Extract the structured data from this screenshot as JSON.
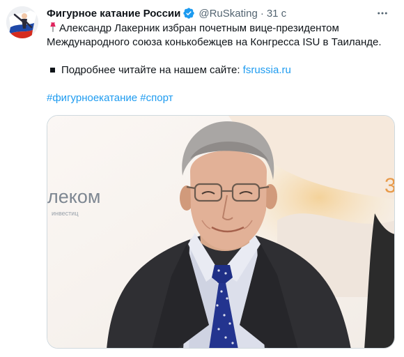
{
  "author": {
    "name": "Фигурное катание России",
    "handle": "@RuSkating",
    "time": "31 с"
  },
  "tweet": {
    "line1": "Александр Лакерник избран почетным вице-президентом",
    "line2": "Международного союза конькобежцев на Конгресса ISU в Таиланде.",
    "read_more": "Подробнее читайте на нашем сайте:",
    "link": "fsrussia.ru",
    "hashtags": "#фигурноекатание #спорт"
  },
  "media": {
    "background_text": "лeком",
    "background_subtext": "инвестиц",
    "number_fragment": "3"
  },
  "icons": {
    "pin": "pushpin-icon",
    "verified": "verified-badge-icon",
    "more": "more-options-icon"
  },
  "colors": {
    "link": "#1d9bf0",
    "secondary_text": "#536471",
    "verified": "#1d9bf0"
  }
}
